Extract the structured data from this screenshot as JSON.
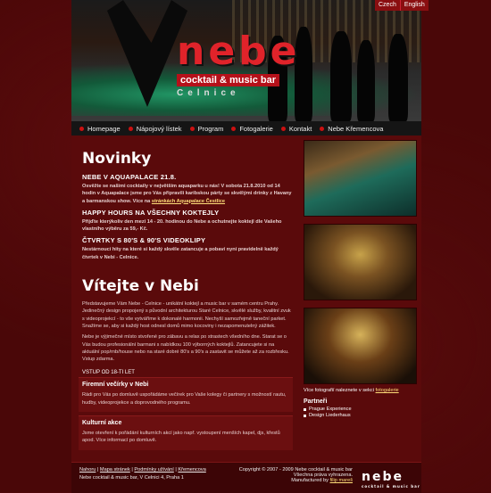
{
  "languages": [
    "Czech",
    "English"
  ],
  "logo": {
    "name": "nebe",
    "subtitle": "cocktail & music bar",
    "city": "Celnice"
  },
  "nav": [
    "Homepage",
    "Nápojový lístek",
    "Program",
    "Fotogalerie",
    "Kontakt",
    "Nebe Křemencova"
  ],
  "news": {
    "title": "Novinky",
    "items": [
      {
        "heading": "NEBE V AQUAPALACE 21.8.",
        "text": "Osvěžte se našimi cocktaily v největším aquaparku u nás! V sobota 21.8.2010 od 14 hodin v Aquapalace jsme pro Vás připravili karibskou párty se skvělými drinky z Havany a barmanskou show. Více na",
        "link": "stránkách Aquapalace Čestlice"
      },
      {
        "heading": "HAPPY HOURS NA VŠECHNY KOKTEJLY",
        "text": "Přijďte kterýkoliv den mezi 14 - 20. hodinou do Nebe a ochutnejte koktejl dle Vašeho vlastního výběru za 59,- Kč."
      },
      {
        "heading": "ČTVRTKY S 80'S & 90'S VIDEOKLIPY",
        "text": "Nestárnoucí hity na které si každý skvěle zatancuje a pobaví nyní pravidelně každý čtvrtek v Nebi - Celnice."
      }
    ]
  },
  "welcome": {
    "title": "Vítejte v Nebi",
    "text1": "Představujeme Vám Nebe - Celnice - unikátní koktejl a music bar v samém centru Prahy. Jedinečný design propojený s původní architekturou Staré Celnice, skvělé služby, kvalitní zvuk s videoprojekcí - to vše vytváříme k dokonalé harmonii. Nechyší samozřejmě taneční parket. Snažíme se, aby si každý host odnesl domů mimo kocoviny i nezapomenutelný zážitek.",
    "text2": "Nebe je výjimečné místo stvořené pro zábavu a relax po strastech všedního dne. Starat se o Vás budou profesionální barmani s nabídkou 100 výborných koktejlů. Zatancujete si na aktuální pop/rnb/house nebo na staré dobré 80's a 90's a zastavit se můžete až za rozbřesku. Vstup zdarma.",
    "entry": "VSTUP OD 18-TI LET"
  },
  "boxes": [
    {
      "title": "Firemní večírky v Nebi",
      "text": "Rádi pro Vás po domluvě uspořádáme večírek pro Vaše kolegy či partnery s možností rautu, hudby, videoprojekce a doprovodného programu."
    },
    {
      "title": "Kulturní akce",
      "text": "Jsme otevření k pořádání kulturních akcí jako např. vystoupení menších kapel, djs, křestů apod. Více informací po domluvě."
    }
  ],
  "photos": {
    "more_text": "Více fotografií naleznete v sekci",
    "more_link": "fotogalerie"
  },
  "partners": {
    "title": "Partneři",
    "items": [
      "Prague Experience",
      "Design Liederhaus"
    ]
  },
  "footer": {
    "links": [
      "Nahoru",
      "Mapa stránek",
      "Podmínky užívání",
      "Křemencova"
    ],
    "address": "Nebe cocktail & music bar, V Celnici 4, Praha 1",
    "copyright": "Copyright © 2007 - 2009 Nebe cocktail & music bar",
    "rights": "Všechna práva vyhrazena.",
    "manufactured": "Manufactured by",
    "manufacturer": "filip mareš",
    "logo": "nebe",
    "logo_sub": "cocktail & music bar"
  }
}
